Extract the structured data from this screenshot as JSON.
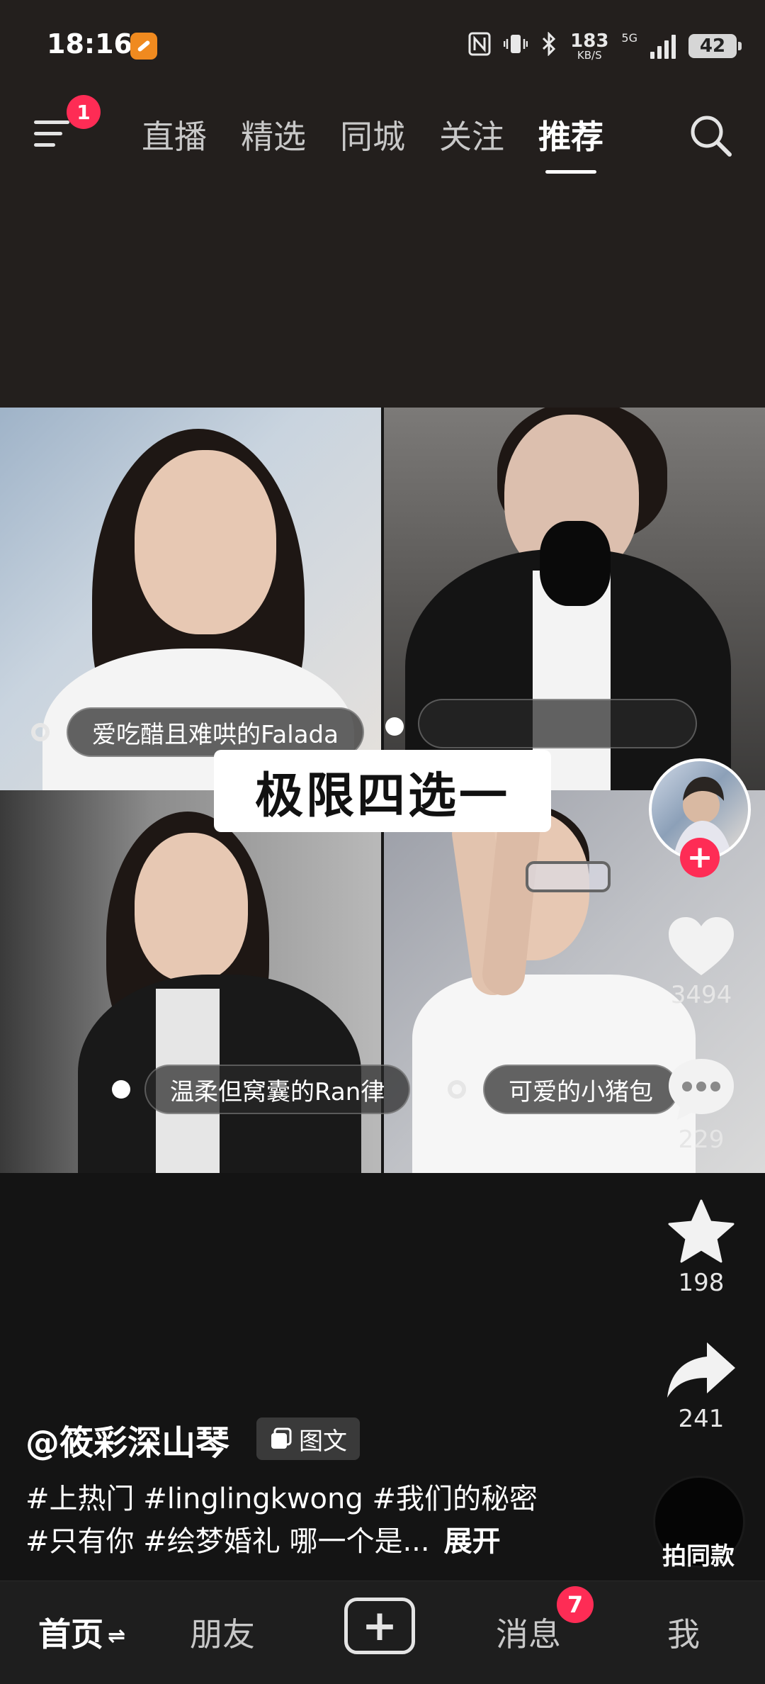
{
  "status_bar": {
    "time": "18:16",
    "net_speed": "183",
    "net_speed_unit": "KB/S",
    "network": "5G",
    "battery": "42",
    "icons": [
      "nfc-icon",
      "vibrate-icon",
      "bluetooth-icon",
      "signal-icon"
    ]
  },
  "top_nav": {
    "menu_badge": "1",
    "tabs": [
      {
        "label": "直播"
      },
      {
        "label": "精选"
      },
      {
        "label": "同城"
      },
      {
        "label": "关注"
      },
      {
        "label": "推荐"
      }
    ],
    "active_tab": "推荐"
  },
  "post": {
    "title_overlay": "极限四选一",
    "captions": [
      "爱吃醋且难哄的Falada",
      "",
      "温柔但窝囊的Ran律",
      "可爱的小猪包"
    ]
  },
  "actions": {
    "likes": "3494",
    "comments": "229",
    "favorites": "198",
    "shares": "241"
  },
  "footer": {
    "author": "@筱彩深山琴",
    "type_badge": "图文",
    "desc_line1": "#上热门 #linglingkwong #我们的秘密",
    "desc_line2": "#只有你 #绘梦婚礼 哪一个是...",
    "expand": "展开",
    "same_style": "拍同款"
  },
  "bottom_nav": {
    "home": "首页",
    "friends": "朋友",
    "messages": "消息",
    "messages_badge": "7",
    "me": "我"
  },
  "colors": {
    "accent": "#fe2c55",
    "top_bg": "#231f1d",
    "bottom_bg": "#141414"
  }
}
